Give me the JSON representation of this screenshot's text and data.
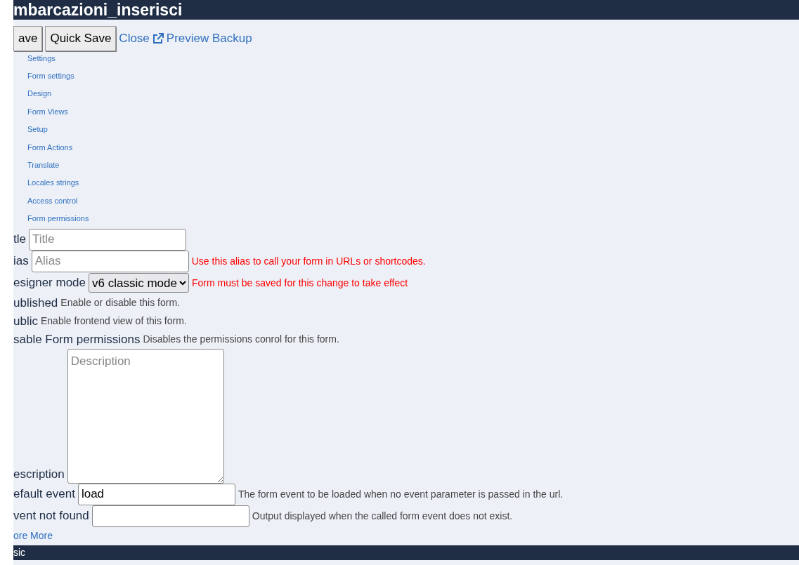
{
  "header": {
    "title": "mbarcazioni_inserisci"
  },
  "toolbar": {
    "buttons": [
      "ave",
      "Quick Save"
    ],
    "links": [
      {
        "label": "Close",
        "kind": "plain"
      },
      {
        "label": "Preview Backup",
        "kind": "external"
      }
    ]
  },
  "menu": [
    "Settings",
    "Form settings",
    "Design",
    "Form Views",
    "Setup",
    "Form Actions",
    "Translate",
    "Locales strings",
    "Access control",
    "Form permissions"
  ],
  "fields": [
    {
      "kind": "input",
      "label": "tle",
      "placeholder": "Title"
    },
    {
      "kind": "input",
      "label": "ias",
      "placeholder": "Alias",
      "help": "Use this alias to call your form in URLs or shortcodes.",
      "warning": true
    },
    {
      "kind": "select",
      "label": "esigner mode",
      "value": "v6 classic mode",
      "help": "Form must be saved for this change to take effect",
      "warning": true
    },
    {
      "kind": "flag",
      "label": "ublished",
      "help": "Enable or disable this form."
    },
    {
      "kind": "flag",
      "label": "ublic",
      "help": "Enable frontend view of this form."
    },
    {
      "kind": "flag",
      "label": "sable Form permissions",
      "help": "Disables the permissions conrol for this form."
    },
    {
      "kind": "textarea",
      "label": "escription",
      "placeholder": "Description"
    },
    {
      "kind": "input",
      "label": "efault event",
      "value": "load",
      "help": "The form event to be loaded when no event parameter is passed in the url."
    },
    {
      "kind": "input",
      "label": "vent not found",
      "help": "Output displayed when the called form event does not exist."
    }
  ],
  "more_link": "ore More",
  "section": {
    "title": "sic"
  }
}
